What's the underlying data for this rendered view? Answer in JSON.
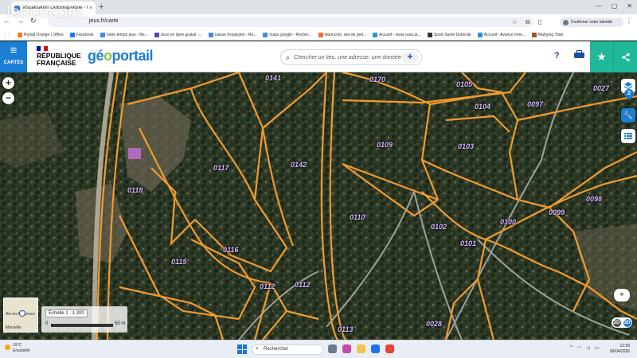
{
  "watermark": "leboncoin",
  "browser": {
    "tab_title": "Visualisation cartographique - Gé",
    "tab_close": "×",
    "new_tab": "+",
    "url": "jeux.fr/carte",
    "identity_button": "Confirmer votre identité",
    "window_controls": [
      "—",
      "▢",
      "✕"
    ],
    "bookmarks": [
      {
        "label": "Portail Orange | Offres",
        "color": "#ff7900"
      },
      {
        "label": "Facebook",
        "color": "#1877f2"
      },
      {
        "label": "notre temps jeux - Re...",
        "color": "#4285f4"
      },
      {
        "label": "Jeux en ligne gratuit -...",
        "color": "#5a3fb5"
      },
      {
        "label": "caisse d'epargne - Re...",
        "color": "#4285f4"
      },
      {
        "label": "maps google - Recher...",
        "color": "#4285f4"
      },
      {
        "label": "leboncoin, site de peti...",
        "color": "#f56b2a"
      },
      {
        "label": "Accueil - www.cesu.ur...",
        "color": "#2d8fd5"
      },
      {
        "label": "Sport Santé Domicile",
        "color": "#333333"
      },
      {
        "label": "Accueil - Avance Imm...",
        "color": "#2d8fd5"
      },
      {
        "label": "Mahjong Titan",
        "color": "#a0522d"
      }
    ]
  },
  "geoportail": {
    "menu_label": "CARTES",
    "republique_line1": "RÉPUBLIQUE",
    "republique_line2": "FRANÇAISE",
    "logo_part1": "gé",
    "logo_part2": "o",
    "logo_part3": "portail",
    "search_placeholder": "Chercher un lieu, une adresse, une donnée",
    "help_label": "?",
    "accent": "#1c7dd4",
    "teal": "#1fb89a"
  },
  "map": {
    "parcel_color": "#f29b2f",
    "parcels": [
      "0141",
      "0170",
      "0105",
      "0027",
      "0104",
      "0097",
      "0109",
      "0103",
      "0117",
      "0142",
      "0118",
      "0098",
      "0099",
      "0100",
      "0102",
      "0110",
      "0101",
      "0115",
      "0116",
      "0112",
      "0112",
      "0113",
      "0028"
    ],
    "layers_count": "2",
    "toggle_2d": "2D",
    "toggle_3d": "3D",
    "minimap_city_1": "Aix-en-Provence",
    "minimap_city_2": "Marseille",
    "scale_label": "Échelle 1 : 1 200",
    "scale_min": "0",
    "scale_max": "50 m"
  },
  "taskbar": {
    "temperature": "19°C",
    "weather": "Ensoleillé",
    "search_label": "Rechercher",
    "time": "12:59",
    "date": "06/04/2026"
  }
}
